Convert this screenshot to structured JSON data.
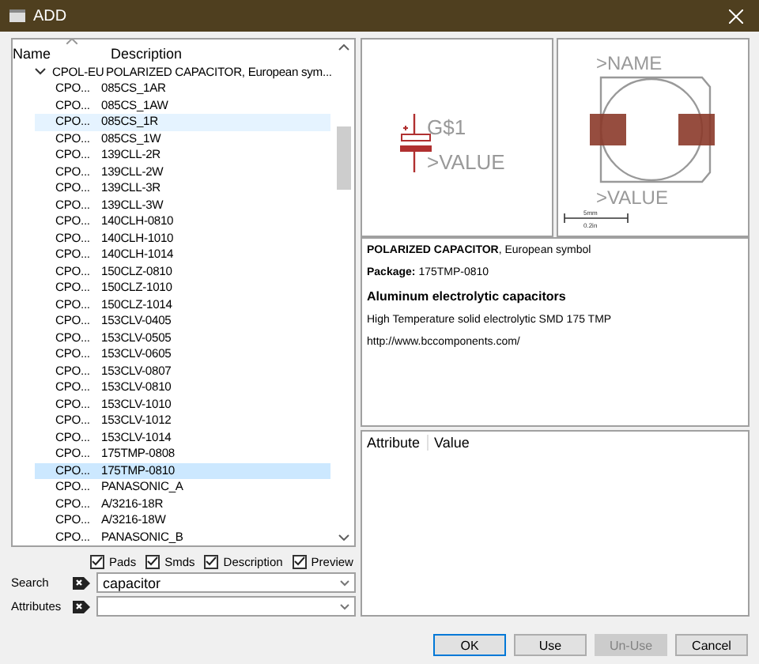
{
  "window": {
    "title": "ADD"
  },
  "tree": {
    "columns": [
      "Name",
      "Description"
    ],
    "root": {
      "name": "CPOL-EU",
      "description": "POLARIZED CAPACITOR, European sym...",
      "expanded": true,
      "children": [
        {
          "name": "CPO...",
          "description": "085CS_1AR",
          "selected": false,
          "hovered": false
        },
        {
          "name": "CPO...",
          "description": "085CS_1AW",
          "selected": false,
          "hovered": false
        },
        {
          "name": "CPO...",
          "description": "085CS_1R",
          "selected": false,
          "hovered": true
        },
        {
          "name": "CPO...",
          "description": "085CS_1W",
          "selected": false,
          "hovered": false
        },
        {
          "name": "CPO...",
          "description": "139CLL-2R",
          "selected": false,
          "hovered": false
        },
        {
          "name": "CPO...",
          "description": "139CLL-2W",
          "selected": false,
          "hovered": false
        },
        {
          "name": "CPO...",
          "description": "139CLL-3R",
          "selected": false,
          "hovered": false
        },
        {
          "name": "CPO...",
          "description": "139CLL-3W",
          "selected": false,
          "hovered": false
        },
        {
          "name": "CPO...",
          "description": "140CLH-0810",
          "selected": false,
          "hovered": false
        },
        {
          "name": "CPO...",
          "description": "140CLH-1010",
          "selected": false,
          "hovered": false
        },
        {
          "name": "CPO...",
          "description": "140CLH-1014",
          "selected": false,
          "hovered": false
        },
        {
          "name": "CPO...",
          "description": "150CLZ-0810",
          "selected": false,
          "hovered": false
        },
        {
          "name": "CPO...",
          "description": "150CLZ-1010",
          "selected": false,
          "hovered": false
        },
        {
          "name": "CPO...",
          "description": "150CLZ-1014",
          "selected": false,
          "hovered": false
        },
        {
          "name": "CPO...",
          "description": "153CLV-0405",
          "selected": false,
          "hovered": false
        },
        {
          "name": "CPO...",
          "description": "153CLV-0505",
          "selected": false,
          "hovered": false
        },
        {
          "name": "CPO...",
          "description": "153CLV-0605",
          "selected": false,
          "hovered": false
        },
        {
          "name": "CPO...",
          "description": "153CLV-0807",
          "selected": false,
          "hovered": false
        },
        {
          "name": "CPO...",
          "description": "153CLV-0810",
          "selected": false,
          "hovered": false
        },
        {
          "name": "CPO...",
          "description": "153CLV-1010",
          "selected": false,
          "hovered": false
        },
        {
          "name": "CPO...",
          "description": "153CLV-1012",
          "selected": false,
          "hovered": false
        },
        {
          "name": "CPO...",
          "description": "153CLV-1014",
          "selected": false,
          "hovered": false
        },
        {
          "name": "CPO...",
          "description": "175TMP-0808",
          "selected": false,
          "hovered": false
        },
        {
          "name": "CPO...",
          "description": "175TMP-0810",
          "selected": true,
          "hovered": false
        },
        {
          "name": "CPO...",
          "description": "PANASONIC_A",
          "selected": false,
          "hovered": false
        },
        {
          "name": "CPO...",
          "description": "A/3216-18R",
          "selected": false,
          "hovered": false
        },
        {
          "name": "CPO...",
          "description": "A/3216-18W",
          "selected": false,
          "hovered": false
        },
        {
          "name": "CPO...",
          "description": "PANASONIC_B",
          "selected": false,
          "hovered": false
        }
      ]
    }
  },
  "options": [
    {
      "label": "Pads",
      "checked": true
    },
    {
      "label": "Smds",
      "checked": true
    },
    {
      "label": "Description",
      "checked": true
    },
    {
      "label": "Preview",
      "checked": true
    }
  ],
  "search": {
    "label": "Search",
    "value": "capacitor"
  },
  "attributes_filter": {
    "label": "Attributes"
  },
  "symbol_preview": {
    "name_label": "G$1",
    "value_label": ">VALUE"
  },
  "package_preview": {
    "name_label": ">NAME",
    "value_label": ">VALUE",
    "scale_top": "5mm",
    "scale_bottom": "0.2in"
  },
  "description": [
    {
      "kind": "text",
      "text": "**POLARIZED CAPACITOR**, European symbol"
    },
    {
      "kind": "text",
      "text": "**Package:** 175TMP-0810"
    },
    {
      "kind": "heading",
      "text": "Aluminum electrolytic capacitors"
    },
    {
      "kind": "text",
      "text": "High Temperature solid electrolytic SMD 175 TMP"
    },
    {
      "kind": "text",
      "text": "http://www.bccomponents.com/"
    }
  ],
  "attribute_table": {
    "columns": [
      "Attribute",
      "Value"
    ]
  },
  "buttons": [
    {
      "label": "OK",
      "default": true,
      "disabled": false
    },
    {
      "label": "Use",
      "default": false,
      "disabled": false
    },
    {
      "label": "Un-Use",
      "default": false,
      "disabled": true
    },
    {
      "label": "Cancel",
      "default": false,
      "disabled": false
    }
  ]
}
